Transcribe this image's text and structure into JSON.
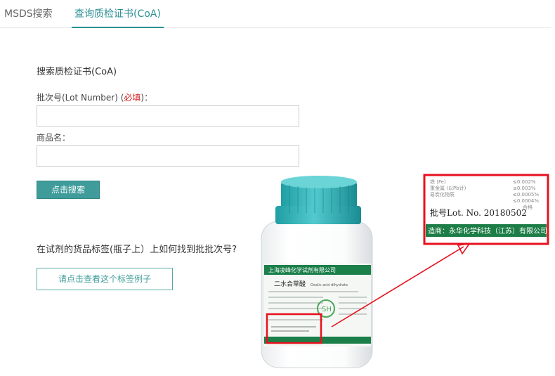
{
  "tabs": [
    {
      "label": "MSDS搜索",
      "active": false
    },
    {
      "label": "查询质检证书(CoA)",
      "active": true
    }
  ],
  "form": {
    "title": "搜索质检证书(CoA)",
    "lot_label": "批次号(Lot Number) (",
    "lot_required": "必填",
    "lot_label_end": ")：",
    "lot_value": "",
    "name_label": "商品名：",
    "name_value": "",
    "search_button": "点击搜索"
  },
  "help": {
    "question": "在试剂的货品标签(瓶子上）上如何找到批批次号?",
    "example_button": "请点击查看这个标签例子"
  },
  "illustration": {
    "label_company": "上海凌峰化学试剂有限公司",
    "label_product": "二水合草酸",
    "label_product_en": "Oxalic acid dihydrate",
    "zoom_lot": "批号Lot. No. 20180502",
    "zoom_maker": "造商：永华化学科技（江苏）有限公司",
    "colors": {
      "highlight": "#e8101e",
      "teal": "#34b3b8"
    }
  }
}
